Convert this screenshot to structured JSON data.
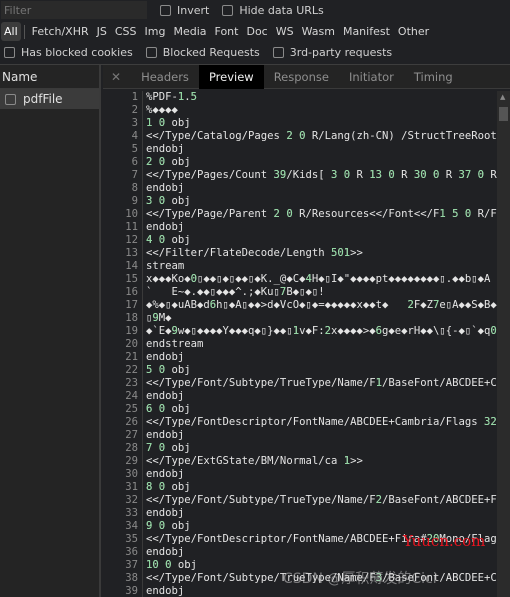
{
  "filter": {
    "placeholder": "Filter",
    "invert": "Invert",
    "hide_data_urls": "Hide data URLs"
  },
  "types": [
    "All",
    "Fetch/XHR",
    "JS",
    "CSS",
    "Img",
    "Media",
    "Font",
    "Doc",
    "WS",
    "Wasm",
    "Manifest",
    "Other"
  ],
  "active_type": "All",
  "checkboxes": [
    "Has blocked cookies",
    "Blocked Requests",
    "3rd-party requests"
  ],
  "requests": {
    "header": "Name",
    "items": [
      "pdfFile"
    ]
  },
  "tabs": [
    "Headers",
    "Preview",
    "Response",
    "Initiator",
    "Timing"
  ],
  "active_tab": "Preview",
  "lines": [
    "%PDF-1.5",
    "%◆◆◆◆",
    "1 0 obj",
    "<</Type/Catalog/Pages 2 0 R/Lang(zh-CN) /StructTreeRoot 189",
    "endobj",
    "2 0 obj",
    "<</Type/Pages/Count 39/Kids[ 3 0 R 13 0 R 30 0 R 37 0 R 40",
    "endobj",
    "3 0 obj",
    "<</Type/Page/Parent 2 0 R/Resources<</Font<</F1 5 0 R/F2 8",
    "endobj",
    "4 0 obj",
    "<</Filter/FlateDecode/Length 501>>",
    "stream",
    "x◆◆◆Ko◆0▯◆◆▯◆▯◆◆▯◆K._@◆C◆4H◆▯I◆\"◆◆◆◆pt◆◆◆◆◆◆◆◆▯.◆◆b▯◆A",
    "`   E~◆.◆◆▯◆◆◆^.;◆Ku▯7B◆▯◆▯!",
    "◆%◆▯◆uAB◆d6h▯◆A▯◆◆>d◆VcO◆▯◆=◆◆◆◆◆x◆◆t◆   2F◆Z7e▯A◆◆S◆B◆",
    "▯9M◆",
    "◆`E◆9w◆▯◆◆◆◆Y◆◆◆q◆▯}◆◆▯1v◆F:2x◆◆◆◆>◆6g◆e◆rH◆◆\\▯{-◆▯`◆q0",
    "endstream",
    "endobj",
    "5 0 obj",
    "<</Type/Font/Subtype/TrueType/Name/F1/BaseFont/ABCDEE+Cambr",
    "endobj",
    "6 0 obj",
    "<</Type/FontDescriptor/FontName/ABCDEE+Cambria/Flags 32/Ita",
    "endobj",
    "7 0 obj",
    "<</Type/ExtGState/BM/Normal/ca 1>>",
    "endobj",
    "8 0 obj",
    "<</Type/Font/Subtype/TrueType/Name/F2/BaseFont/ABCDEE+Fira#",
    "endobj",
    "9 0 obj",
    "<</Type/FontDescriptor/FontName/ABCDEE+Fira#20Mono/Flags 32",
    "endobj",
    "10 0 obj",
    "<</Type/Font/Subtype/TrueType/Name/F3/BaseFont/ABCDEE+Calib",
    "endobj"
  ],
  "colors": {
    "number": "#8fd8a0",
    "active_tab_bg": "#000000",
    "selected_row": "#3b3b3b"
  },
  "watermarks": [
    "Yuucn.com",
    "CSDN @厚积薄发的Cici"
  ]
}
